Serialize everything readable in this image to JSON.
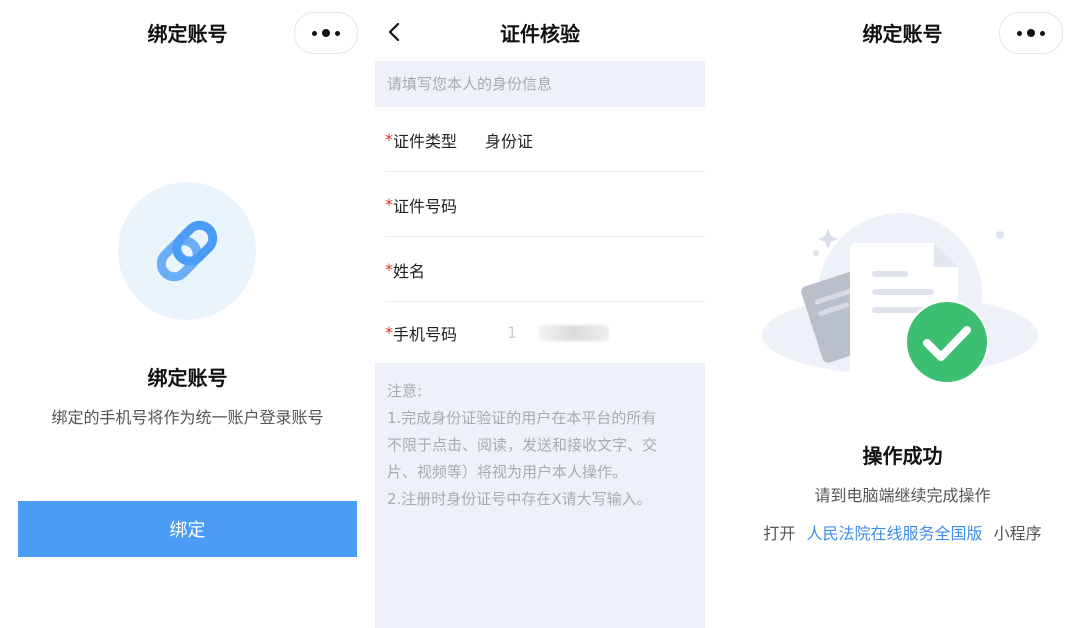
{
  "screen1": {
    "nav_title": "绑定账号",
    "heading": "绑定账号",
    "description": "绑定的手机号将作为统一账户登录账号",
    "bind_button": "绑定"
  },
  "screen2": {
    "nav_title": "证件核验",
    "tip": "请填写您本人的身份信息",
    "fields": [
      {
        "required_mark": "*",
        "label": "证件类型",
        "value": "身份证"
      },
      {
        "required_mark": "*",
        "label": "证件号码",
        "value": ""
      },
      {
        "required_mark": "*",
        "label": "姓名",
        "value": ""
      },
      {
        "required_mark": "*",
        "label": "手机号码",
        "value": "1"
      }
    ],
    "notice": {
      "title": "注意:",
      "lines": [
        "1.完成身份证验证的用户在本平台的所有",
        "不限于点击、阅读，发送和接收文字、交",
        "片、视频等）将视为用户本人操作。",
        "2.注册时身份证号中存在X请大写输入。"
      ]
    }
  },
  "screen3": {
    "nav_title": "绑定账号",
    "heading": "操作成功",
    "subtitle": "请到电脑端继续完成操作",
    "open_prefix": "打开",
    "open_link": "人民法院在线服务全国版",
    "open_suffix": "小程序"
  },
  "colors": {
    "accent_blue": "#4a9cf4",
    "link_blue": "#3f8fe8",
    "success_green": "#3dbf72",
    "required_red": "#d9352c",
    "notice_bg": "#eef1f8"
  }
}
